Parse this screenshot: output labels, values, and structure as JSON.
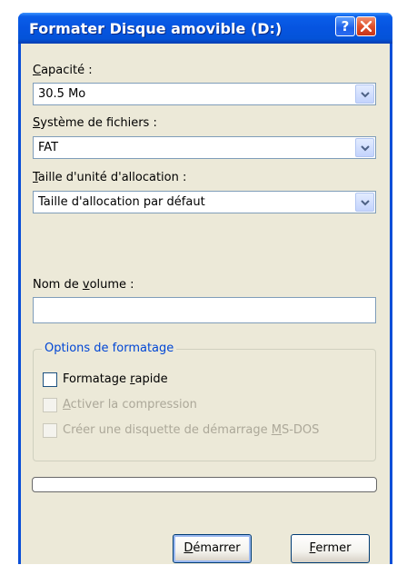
{
  "window": {
    "title": "Formater Disque amovible (D:)",
    "help_label": "?"
  },
  "capacity": {
    "label": "Capacité :",
    "value": "30.5 Mo"
  },
  "filesystem": {
    "label": "Système de fichiers :",
    "value": "FAT"
  },
  "allocation": {
    "label": "Taille d'unité d'allocation :",
    "value": "Taille d'allocation par défaut"
  },
  "volume": {
    "label": "Nom de volume :",
    "value": ""
  },
  "options": {
    "legend": "Options de formatage",
    "quick_format": {
      "label": "Formatage rapide",
      "checked": false,
      "enabled": true
    },
    "compression": {
      "label": "Activer la compression",
      "checked": false,
      "enabled": false
    },
    "boot_disk": {
      "label": "Créer une disquette de démarrage MS-DOS",
      "checked": false,
      "enabled": false
    }
  },
  "progress": {
    "value": 0
  },
  "buttons": {
    "start": "Démarrer",
    "close": "Fermer"
  },
  "colors": {
    "titlebar": "#0054e3",
    "dialog_bg": "#ece9d8",
    "group_legend": "#0046d5",
    "close_button": "#e0502a",
    "disabled_text": "#aca899"
  }
}
